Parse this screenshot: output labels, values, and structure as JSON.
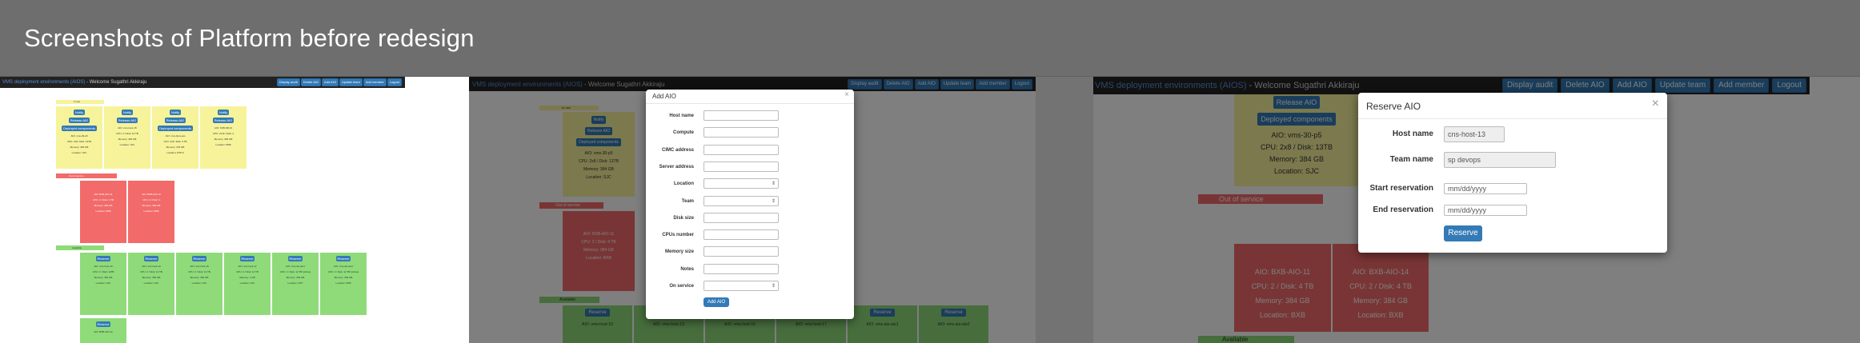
{
  "slide": {
    "title": "Screenshots of Platform before redesign"
  },
  "app": {
    "brand": "VMS deployment environments (AIOS)",
    "welcome": " - Welcome Sugathri Akkiraju",
    "nav": [
      "Display audit",
      "Delete AIO",
      "Add AIO",
      "Update team",
      "Add member",
      "Logout"
    ]
  },
  "sections": {
    "in_use": "In use",
    "out_of_service": "Out of service",
    "available": "Available"
  },
  "buttons": {
    "notify": "Notify",
    "release": "Release AIO",
    "deployed": "Deployed components",
    "reserve": "Reserve"
  },
  "shot1": {
    "in_use_cards": [
      {
        "aio": "AIO: vms-30-p5",
        "spec": "CPU: 2x8 / Disk: 13TB",
        "memory": "Memory: 384 GB",
        "location": "Location: SJC"
      },
      {
        "aio": "AIO: vms-host-15",
        "spec": "CPU: 2 / Disk: 12 TB",
        "memory": "Memory: 384 GB",
        "location": "Location: SJC"
      },
      {
        "aio": "AIO: vms-fpms-aio",
        "spec": "CPU: 2x8 / Disk: 4 TB",
        "memory": "Memory: 378 GB",
        "location": "Location: RTP-5"
      },
      {
        "aio": "AIO: SXB-SB-13",
        "spec": "CPU: 2x16 / Disk: 4",
        "memory": "Memory: 384 GB",
        "location": "Location: BXB"
      }
    ],
    "oos_cards": [
      {
        "aio": "AIO: BXB-AIO-11",
        "spec": "CPU: 2 / Disk: 4 TB",
        "memory": "Memory: 384 GB",
        "location": "Location: BXB"
      },
      {
        "aio": "AIO: BXB-AIO-14",
        "spec": "CPU: 2 / Disk: 4",
        "memory": "Memory: 384 GB",
        "location": "Location: BXB"
      }
    ],
    "available_cards": [
      {
        "aio": "AIO: vms-host-10",
        "spec": "CPU: 2 / Disk: 14TB",
        "memory": "Memory: 384 GB",
        "location": "Location: SJC"
      },
      {
        "aio": "AIO: vms-host-13",
        "spec": "CPU: 2 / Disk: 12 TB",
        "memory": "Memory: 384 GB",
        "location": "Location: SJC"
      },
      {
        "aio": "AIO: vms-host-16",
        "spec": "CPU: 2 / Disk: 14 TB",
        "memory": "Memory: 384 GB",
        "location": "Location: SJC"
      },
      {
        "aio": "AIO: vms-host-17",
        "spec": "CPU: 2 / Disk: 14 TB",
        "memory": "Memory: 1 GB",
        "location": "Location: SJC"
      },
      {
        "aio": "AIO: vms-aio-aio1",
        "spec": "CPU: 2 / Disk: 12 TB (Active)",
        "memory": "Memory: 384 GB",
        "location": "Location: RTP"
      },
      {
        "aio": "AIO: vms-aio-aio2",
        "spec": "CPU: 2 / Disk: 12 TB (Active)",
        "memory": "Memory: 384 GB",
        "location": "Location: BXB"
      }
    ],
    "last_card": {
      "aio": "AIO: BXB-AIO-12"
    }
  },
  "shot2": {
    "bg_cards": [
      {
        "aio": "AIO: vms-30-p5",
        "spec": "CPU: 2x8 / Disk: 13TB",
        "memory": "Memory: 384 GB",
        "location": "Location: SJC"
      },
      {
        "aio": "AIO: BXB-AIO-11",
        "spec": "CPU: 2 / Disk: 4 TB",
        "memory": "Memory: 384 GB",
        "location": "Location: BXB"
      }
    ],
    "available_row": [
      "AIO: vms-host-10",
      "AIO: vms-host-13",
      "AIO: vms-host-16",
      "AIO: vms-host-17",
      "AIO: vms-aio-aio1",
      "AIO: vms-aio-aio2"
    ],
    "modal": {
      "title": "Add AIO",
      "close": "×",
      "fields": [
        {
          "label": "Host name",
          "type": "text"
        },
        {
          "label": "Compute",
          "type": "text"
        },
        {
          "label": "CIMC address",
          "type": "text"
        },
        {
          "label": "Server address",
          "type": "text"
        },
        {
          "label": "Location",
          "type": "select"
        },
        {
          "label": "Team",
          "type": "select"
        },
        {
          "label": "Disk size",
          "type": "text"
        },
        {
          "label": "CPUs number",
          "type": "text"
        },
        {
          "label": "Memory size",
          "type": "text"
        },
        {
          "label": "Notes",
          "type": "text"
        },
        {
          "label": "On service",
          "type": "select"
        }
      ],
      "submit": "Add AIO"
    }
  },
  "shot3": {
    "bg_cards": [
      {
        "aio": "AIO: vms-30-p5",
        "spec": "CPU: 2x8 / Disk: 13TB",
        "memory": "Memory: 384 GB",
        "location": "Location: SJC"
      },
      {
        "aio": "AIO: BXB-AIO-11",
        "spec": "CPU: 2 / Disk: 4 TB",
        "memory": "Memory: 384 GB",
        "location": "Location: BXB"
      },
      {
        "aio": "AIO: BXB-AIO-14",
        "spec": "CPU: 2 / Disk: 4 TB",
        "memory": "Memory: 384 GB",
        "location": "Location: BXB"
      }
    ],
    "modal": {
      "title": "Reserve AIO",
      "close": "×",
      "fields": [
        {
          "label": "Host name",
          "value": "cns-host-13"
        },
        {
          "label": "Team name",
          "value": "sp devops"
        },
        {
          "label": "Start reservation",
          "value": "mm/dd/yyyy"
        },
        {
          "label": "End reservation",
          "value": "mm/dd/yyyy"
        }
      ],
      "submit": "Reserve"
    }
  }
}
